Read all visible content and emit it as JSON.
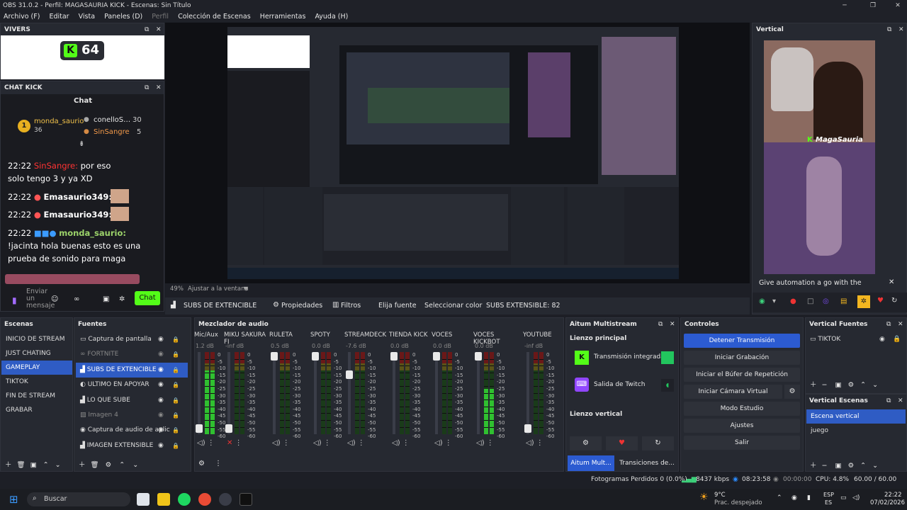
{
  "window": {
    "title": "OBS 31.0.2 - Perfil: MAGASAURIA KICK - Escenas: Sin Título"
  },
  "menu": [
    "Archivo (F)",
    "Editar",
    "Vista",
    "Paneles (D)",
    "Perfil",
    "Colección de Escenas",
    "Herramientas",
    "Ayuda (H)"
  ],
  "viewers": {
    "dock_title": "VIVERS",
    "count": "64"
  },
  "chat": {
    "dock_title": "CHAT KICK",
    "header": "Chat",
    "leaderboard": {
      "first_rank": "1",
      "first_user": "monda_saurio",
      "first_count": "36",
      "second_user": "conelloS…",
      "second_count": "30",
      "third_user": "SinSangre",
      "third_count": "5"
    },
    "messages": [
      {
        "time": "22:22",
        "user": "SinSangre:",
        "text": "por eso",
        "cont": "solo tengo 3 y ya XD"
      },
      {
        "time": "22:22",
        "user": "Emasaurio349:",
        "text": ""
      },
      {
        "time": "22:22",
        "user": "Emasaurio349:",
        "text": ""
      },
      {
        "time": "22:22",
        "user": "monda_saurio:",
        "text": "",
        "cont": "!jacinta hola buenas esto es una",
        "cont2": "prueba de sonido para maga"
      }
    ],
    "input_placeholder": "Enviar un mensaje",
    "send_label": "Chat"
  },
  "preview": {
    "zoom": "49%",
    "fit": "Ajustar a la ventana"
  },
  "source_toolbar": {
    "selected_source": "SUBS DE EXTENCIBLE",
    "properties": "Propiedades",
    "filters": "Filtros",
    "choose_source": "Elija fuente",
    "select_color": "Seleccionar color",
    "status": "SUBS EXTENSIBLE: 82"
  },
  "vertical": {
    "dock_title": "Vertical",
    "overlay_name": "MagaSauria",
    "automation_text": "Give automation a go with the Aitum App"
  },
  "scenes": {
    "title": "Escenas",
    "items": [
      "INICIO DE STREAM",
      "JUST CHATING",
      "GAMEPLAY",
      "TIKTOK",
      "FIN DE STREAM",
      "GRABAR"
    ],
    "selected": 2
  },
  "sources": {
    "title": "Fuentes",
    "items": [
      "Captura de pantalla",
      "FORTNITE",
      "SUBS DE EXTENCIBLE",
      "ULTIMO EN APOYAR",
      "LO QUE SUBE",
      "Imagen 4",
      "Captura de audio de aplic",
      "IMAGEN EXTENSIBLE"
    ]
  },
  "mixer": {
    "title": "Mezclador de audio",
    "channels": [
      {
        "name": "Mic/Aux",
        "db": "1.2 dB",
        "level": 0.8
      },
      {
        "name": "MIKU SAKURA FI",
        "db": "-inf dB",
        "level": 0.0
      },
      {
        "name": "RULETA",
        "db": "0.5 dB",
        "level": 0.0
      },
      {
        "name": "SPOTY",
        "db": "0.0 dB",
        "level": 0.0
      },
      {
        "name": "STREAMDECK",
        "db": "-7.6 dB",
        "level": 0.0
      },
      {
        "name": "TIENDA KICK",
        "db": "0.0 dB",
        "level": 0.0
      },
      {
        "name": "VOCES",
        "db": "0.0 dB",
        "level": 0.0
      },
      {
        "name": "VOCES KICKBOT",
        "db": "0.0 dB",
        "level": 0.55
      },
      {
        "name": "YOUTUBE",
        "db": "-inf dB",
        "level": 0.0
      }
    ],
    "scale": [
      "0",
      "-5",
      "-10",
      "-15",
      "-20",
      "-25",
      "-30",
      "-35",
      "-40",
      "-45",
      "-50",
      "-55",
      "-60"
    ]
  },
  "aitum": {
    "title": "Aitum Multistream",
    "main_canvas": "Lienzo principal",
    "integrated": "Transmisión integrada",
    "twitch": "Salida de Twitch",
    "vertical_canvas": "Lienzo vertical",
    "tab1": "Aitum Mult...",
    "tab2": "Transiciones de..."
  },
  "controls": {
    "title": "Controles",
    "stop": "Detener Transmisión",
    "record": "Iniciar Grabación",
    "replay": "Iniciar el Búfer de Repetición",
    "vcam": "Iniciar Cámara Virtual",
    "studio": "Modo Estudio",
    "settings": "Ajustes",
    "exit": "Salir"
  },
  "vsources": {
    "title": "Vertical Fuentes",
    "items": [
      "TIKTOK"
    ]
  },
  "vscenes": {
    "title": "Vertical Escenas",
    "items": [
      "Escena vertical",
      "juego"
    ]
  },
  "status": {
    "dropped": "Fotogramas Perdidos 0 (0.0%)",
    "bitrate": "8437 kbps",
    "live": "08:23:58",
    "rec": "00:00:00",
    "cpu": "CPU: 4.8%",
    "fps": "60.00 / 60.00 FPS"
  },
  "taskbar": {
    "search": "Buscar",
    "weather_temp": "9°C",
    "weather_desc": "Prac. despejado",
    "lang": "ESP",
    "lang2": "ES",
    "time": "22:22",
    "date": "07/02/2026"
  }
}
